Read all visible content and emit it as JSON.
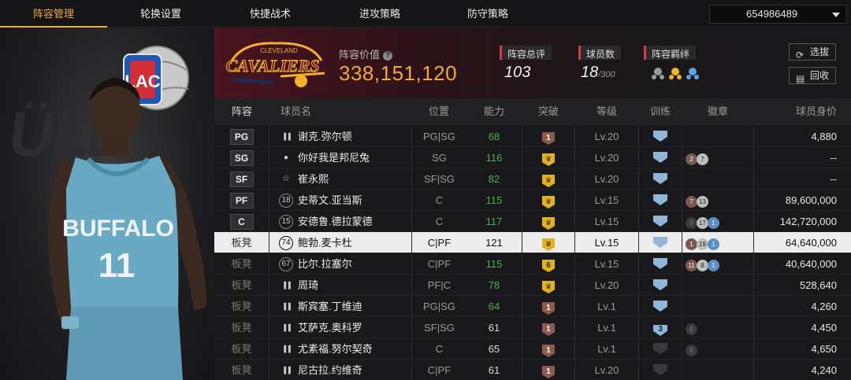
{
  "nav": {
    "tabs": [
      "阵容管理",
      "轮换设置",
      "快捷战术",
      "进攻策略",
      "防守策略"
    ],
    "active_index": 0,
    "account_value": "654986489"
  },
  "left_panel": {
    "team_logo_text": "LAC",
    "jersey_text_line1": "BUFFALO",
    "jersey_number": "11"
  },
  "header": {
    "logo_text_top": "CLEVELAND",
    "logo_text_main": "CAVALIERS",
    "lineup_value_label": "阵容价值",
    "lineup_value": "338,151,120",
    "overall_label": "阵容总评",
    "overall_value": "103",
    "players_label": "球员数",
    "players_value": "18",
    "players_max": "/300",
    "chemistry_label": "阵容羁绊",
    "select_button": "选拔",
    "recycle_button": "回收"
  },
  "table": {
    "headers": [
      "阵容",
      "球员名",
      "位置",
      "能力",
      "突破",
      "等级",
      "训练",
      "徽章",
      "球员身价"
    ],
    "rows": [
      {
        "slot": "PG",
        "starter": true,
        "jersey": "",
        "jersey_icon": "stats-icon",
        "name": "谢克.弥尔顿",
        "role": "PG|SG",
        "ability": "68",
        "ability_color": "#4caf50",
        "break": "1",
        "break_type": "bronze",
        "level": "Lv.20",
        "train": "",
        "badges": [],
        "worth": "4,880"
      },
      {
        "slot": "SG",
        "starter": true,
        "jersey": "",
        "jersey_icon": "person-icon",
        "name": "你好我是邦尼兔",
        "role": "SG",
        "ability": "116",
        "ability_color": "#4caf50",
        "break": "",
        "break_type": "gold",
        "level": "Lv.20",
        "train": "",
        "badges": [
          {
            "t": "2",
            "c": "br"
          },
          {
            "t": "7",
            "c": "sv"
          }
        ],
        "worth": "--"
      },
      {
        "slot": "SF",
        "starter": true,
        "jersey": "",
        "jersey_icon": "star-icon",
        "name": "崔永熙",
        "role": "SF|SG",
        "ability": "82",
        "ability_color": "#4caf50",
        "break": "",
        "break_type": "gold",
        "level": "Lv.20",
        "train": "",
        "badges": [],
        "worth": "--"
      },
      {
        "slot": "PF",
        "starter": true,
        "jersey": "18",
        "jersey_icon": "",
        "name": "史蒂文.亚当斯",
        "role": "C",
        "ability": "115",
        "ability_color": "#4caf50",
        "break": "",
        "break_type": "gold",
        "level": "Lv.15",
        "train": "",
        "badges": [
          {
            "t": "7",
            "c": "br"
          },
          {
            "t": "13",
            "c": "sv"
          }
        ],
        "worth": "89,600,000"
      },
      {
        "slot": "C",
        "starter": true,
        "jersey": "15",
        "jersey_icon": "",
        "name": "安德鲁.德拉蒙德",
        "role": "C",
        "ability": "117",
        "ability_color": "#4caf50",
        "break": "",
        "break_type": "gold",
        "level": "Lv.15",
        "train": "",
        "badges": [
          {
            "t": "0",
            "c": "dk"
          },
          {
            "t": "17",
            "c": "sv"
          },
          {
            "t": "1",
            "c": "bl"
          }
        ],
        "worth": "142,720,000"
      },
      {
        "slot": "板凳",
        "starter": false,
        "jersey": "74",
        "jersey_icon": "",
        "name": "鲍勃.麦卡杜",
        "role": "C|PF",
        "ability": "121",
        "ability_color": "#111111",
        "break": "",
        "break_type": "gold",
        "level": "Lv.15",
        "train": "",
        "badges": [
          {
            "t": "1",
            "c": "br"
          },
          {
            "t": "19",
            "c": "sv"
          },
          {
            "t": "1",
            "c": "bl"
          }
        ],
        "worth": "64,640,000",
        "selected": true
      },
      {
        "slot": "板凳",
        "starter": false,
        "jersey": "67",
        "jersey_icon": "",
        "name": "比尔.拉塞尔",
        "role": "C|PF",
        "ability": "115",
        "ability_color": "#4caf50",
        "break": "6",
        "break_type": "gold",
        "level": "Lv.15",
        "train": "",
        "badges": [
          {
            "t": "11",
            "c": "br"
          },
          {
            "t": "8",
            "c": "sv"
          },
          {
            "t": "1",
            "c": "bl"
          }
        ],
        "worth": "40,640,000"
      },
      {
        "slot": "板凳",
        "starter": false,
        "jersey": "",
        "jersey_icon": "stats-icon",
        "name": "周琦",
        "role": "PF|C",
        "ability": "78",
        "ability_color": "#4caf50",
        "break": "",
        "break_type": "gold",
        "level": "Lv.20",
        "train": "",
        "badges": [],
        "worth": "528,640"
      },
      {
        "slot": "板凳",
        "starter": false,
        "jersey": "",
        "jersey_icon": "stats-icon",
        "name": "斯宾塞.丁维迪",
        "role": "PG|SG",
        "ability": "64",
        "ability_color": "#4caf50",
        "break": "1",
        "break_type": "bronze",
        "level": "Lv.1",
        "train": "",
        "badges": [],
        "worth": "4,260"
      },
      {
        "slot": "板凳",
        "starter": false,
        "jersey": "",
        "jersey_icon": "stats-icon",
        "name": "艾萨克.奥科罗",
        "role": "SF|SG",
        "ability": "61",
        "ability_color": "#dddddd",
        "break": "1",
        "break_type": "bronze",
        "level": "Lv.1",
        "train": "3",
        "badges": [
          {
            "t": "0",
            "c": "dk"
          }
        ],
        "worth": "4,450"
      },
      {
        "slot": "板凳",
        "starter": false,
        "jersey": "",
        "jersey_icon": "stats-icon",
        "name": "尤素福.努尔契奇",
        "role": "C",
        "ability": "65",
        "ability_color": "#dddddd",
        "break": "1",
        "break_type": "bronze",
        "level": "Lv.1",
        "train": "dark",
        "badges": [
          {
            "t": "0",
            "c": "dk"
          }
        ],
        "worth": "4,650"
      },
      {
        "slot": "板凳",
        "starter": false,
        "jersey": "",
        "jersey_icon": "stats-icon",
        "name": "尼古拉.约维奇",
        "role": "C|PF",
        "ability": "61",
        "ability_color": "#dddddd",
        "break": "1",
        "break_type": "bronze",
        "level": "Lv.20",
        "train": "dark",
        "badges": [],
        "worth": "4,240"
      }
    ]
  }
}
